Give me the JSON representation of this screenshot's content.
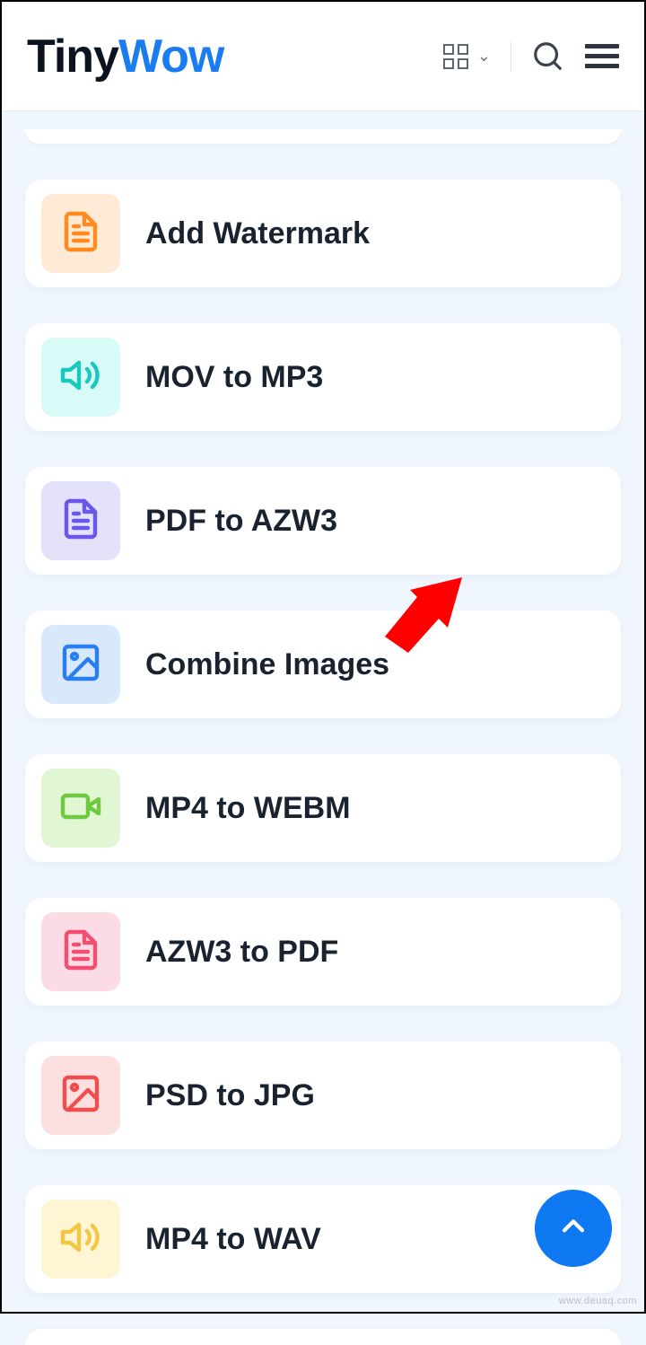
{
  "brand": {
    "part1": "Tiny",
    "part2": "Wow"
  },
  "tools": [
    {
      "label": "Add Watermark",
      "icon": "document-icon",
      "tile_bg": "#ffead6",
      "icon_color": "#ff8a1f"
    },
    {
      "label": "MOV to MP3",
      "icon": "speaker-icon",
      "tile_bg": "#d8fbf7",
      "icon_color": "#19c8bd"
    },
    {
      "label": "PDF to AZW3",
      "icon": "document-icon",
      "tile_bg": "#e4e1fb",
      "icon_color": "#6a57e8"
    },
    {
      "label": "Combine Images",
      "icon": "image-icon",
      "tile_bg": "#d9e9fc",
      "icon_color": "#2a7ff0"
    },
    {
      "label": "MP4 to WEBM",
      "icon": "video-icon",
      "tile_bg": "#e1f6d2",
      "icon_color": "#6fc93e"
    },
    {
      "label": "AZW3 to PDF",
      "icon": "document-icon",
      "tile_bg": "#fcdce4",
      "icon_color": "#f34d72"
    },
    {
      "label": "PSD to JPG",
      "icon": "image-icon",
      "tile_bg": "#fcdfdf",
      "icon_color": "#ef4e4e"
    },
    {
      "label": "MP4 to WAV",
      "icon": "speaker-icon",
      "tile_bg": "#fef5d5",
      "icon_color": "#f2c744"
    }
  ],
  "annotation_arrow_target_index": 3,
  "watermark": "www.deuaq.com"
}
